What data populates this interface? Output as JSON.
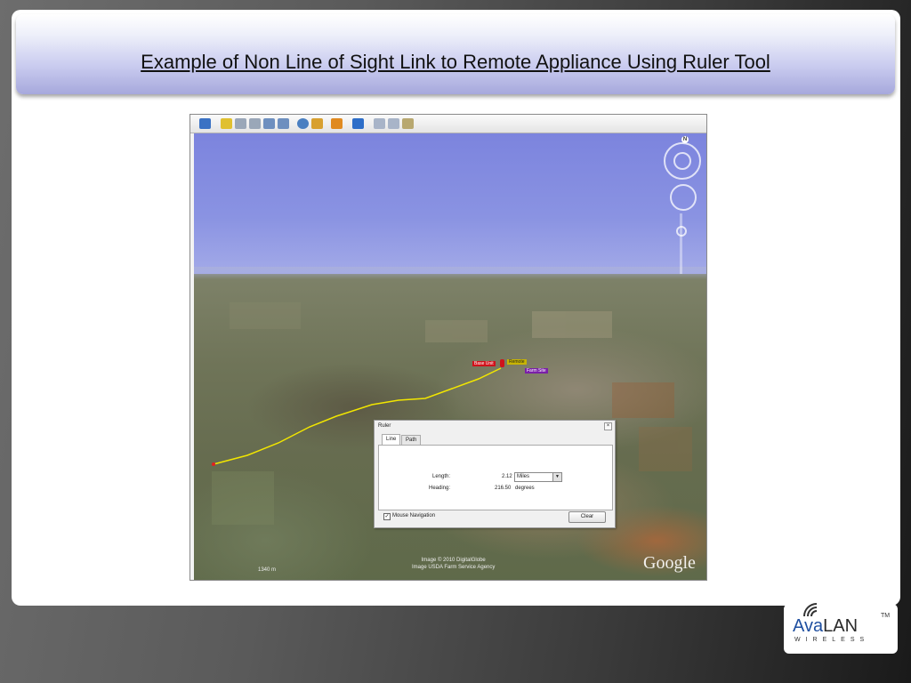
{
  "slide": {
    "title": "Example of Non Line of Sight Link to Remote Appliance Using Ruler Tool"
  },
  "toolbar": {
    "buttons": [
      "sidebar-toggle",
      "placemark",
      "polygon",
      "path",
      "image-overlay",
      "tour",
      "historical-imagery",
      "sunlight",
      "planet",
      "ruler",
      "email",
      "print",
      "view-in-maps"
    ]
  },
  "map": {
    "compass_label": "N",
    "pins": [
      {
        "label": "Base Unit",
        "color": "#d0121b"
      },
      {
        "label": "Remote",
        "color": "#c8b400"
      },
      {
        "label": "Farm Site",
        "color": "#7a1fa8"
      }
    ],
    "attribution_line1": "Image © 2010 DigitalGlobe",
    "attribution_line2": "Image USDA Farm Service Agency",
    "altitude": "1340 m",
    "logo": "Google"
  },
  "ruler": {
    "title": "Ruler",
    "tabs": [
      "Line",
      "Path"
    ],
    "length_label": "Length:",
    "length_value": "2.12",
    "length_unit": "Miles",
    "heading_label": "Heading:",
    "heading_value": "216.50",
    "heading_unit": "degrees",
    "mouse_nav_label": "Mouse Navigation",
    "mouse_nav_checked": true,
    "clear_label": "Clear"
  },
  "brand": {
    "name_part1": "Ava",
    "name_part2": "LAN",
    "trademark": "TM",
    "tagline": "WIRELESS"
  }
}
